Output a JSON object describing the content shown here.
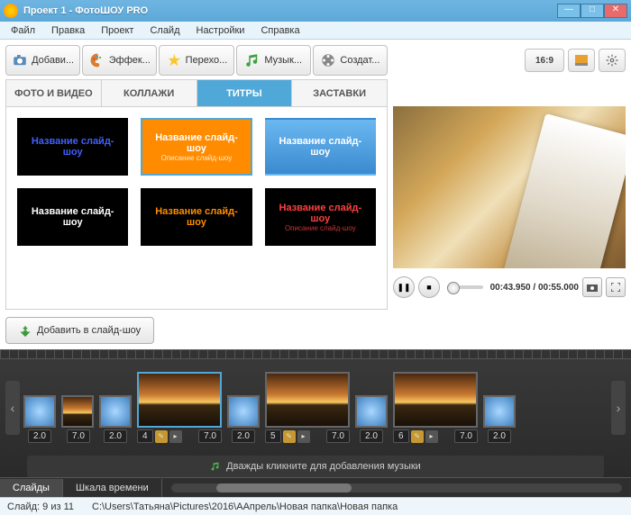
{
  "window": {
    "title": "Проект 1 - ФотоШОУ PRO"
  },
  "menu": {
    "file": "Файл",
    "edit": "Правка",
    "project": "Проект",
    "slide": "Слайд",
    "settings": "Настройки",
    "help": "Справка"
  },
  "toolbar": {
    "add": "Добави...",
    "effects": "Эффек...",
    "transitions": "Перехо...",
    "music": "Музык...",
    "create": "Создат..."
  },
  "right": {
    "ratio": "16:9"
  },
  "subtabs": {
    "photo": "ФОТО И ВИДЕО",
    "collage": "КОЛЛАЖИ",
    "titles": "ТИТРЫ",
    "splash": "ЗАСТАВКИ"
  },
  "thumbs": [
    {
      "label": "Название слайд-шоу",
      "bg": "#000",
      "color": "#4060ff",
      "sel": false
    },
    {
      "label": "Название слайд-шоу",
      "sub": "Описание слайд-шоу",
      "bg": "#ff8c00",
      "color": "#fff",
      "sel": true
    },
    {
      "label": "Название слайд-шоу",
      "bg": "linear-gradient(#6bb8f0,#3a8ad0)",
      "color": "#fff",
      "sel": false
    },
    {
      "label": "Название слайд-шоу",
      "bg": "#000",
      "color": "#fff",
      "sel": false
    },
    {
      "label": "Название слайд-шоу",
      "bg": "#000",
      "color": "#ff8c00",
      "sel": false
    },
    {
      "label": "Название слайд-шоу",
      "sub": "Описание слайд-шоу",
      "bg": "#000",
      "color": "#ff4040",
      "sel": false
    }
  ],
  "addBtn": "Добавить в слайд-шоу",
  "player": {
    "time": "00:43.950 / 00:55.000"
  },
  "timeline": {
    "clips": [
      {
        "type": "trans",
        "dur": "2.0",
        "num": ""
      },
      {
        "type": "slide",
        "dur": "7.0",
        "num": "",
        "sel": false,
        "small": true
      },
      {
        "type": "trans",
        "dur": "2.0",
        "num": ""
      },
      {
        "type": "slide",
        "dur": "7.0",
        "num": "4",
        "sel": true
      },
      {
        "type": "trans",
        "dur": "2.0",
        "num": ""
      },
      {
        "type": "slide",
        "dur": "7.0",
        "num": "5",
        "sel": false
      },
      {
        "type": "trans",
        "dur": "2.0",
        "num": ""
      },
      {
        "type": "slide",
        "dur": "7.0",
        "num": "6",
        "sel": false
      },
      {
        "type": "trans",
        "dur": "2.0",
        "num": ""
      }
    ],
    "music": "Дважды кликните для добавления музыки"
  },
  "bottomTabs": {
    "slides": "Слайды",
    "scale": "Шкала времени"
  },
  "status": {
    "slide": "Слайд: 9 из 11",
    "path": "C:\\Users\\Татьяна\\Pictures\\2016\\ААпрель\\Новая папка\\Новая папка"
  }
}
